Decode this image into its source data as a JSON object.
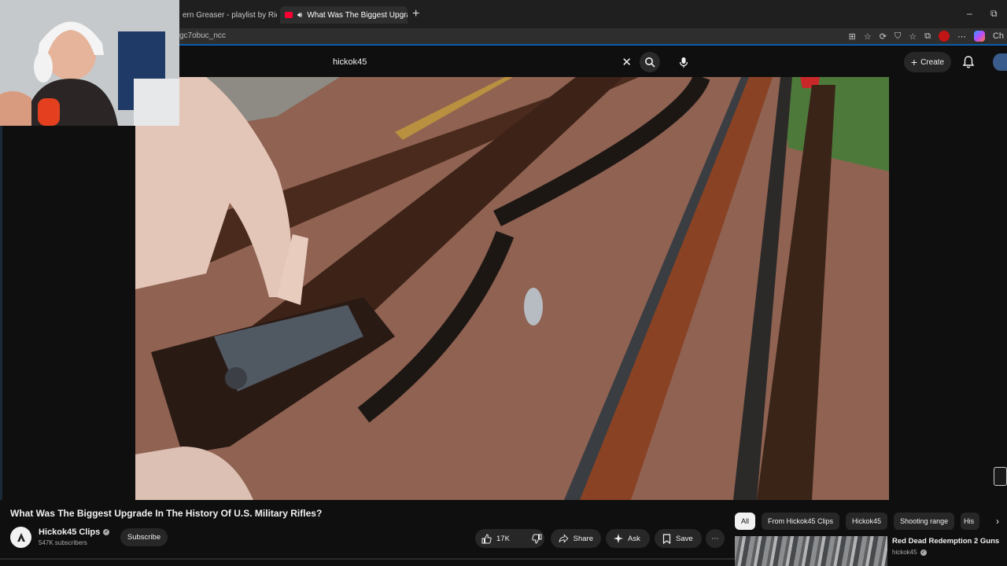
{
  "browser": {
    "tabs": [
      {
        "label": "ern Greaser - playlist by Rich",
        "active": false
      },
      {
        "label": "What Was The Biggest Upgra",
        "active": true
      }
    ],
    "url": "gc7obuc_ncc",
    "new_tab": "+",
    "window_controls": {
      "minimize": "–",
      "restore": "⧉"
    }
  },
  "header": {
    "search_query": "hickok45",
    "create_label": "Create"
  },
  "video": {
    "title": "What Was The Biggest Upgrade In The History Of U.S. Military Rifles?",
    "channel": "Hickok45 Clips",
    "subscribers": "547K subscribers",
    "subscribe_label": "Subscribe",
    "likes": "17K",
    "share_label": "Share",
    "ask_label": "Ask",
    "save_label": "Save"
  },
  "chips": [
    "All",
    "From Hickok45 Clips",
    "Hickok45",
    "Shooting range",
    "His"
  ],
  "recommendation": {
    "title": "Red Dead Redemption 2 Guns",
    "channel": "hickok45"
  },
  "colors": {
    "background": "#0f0f0f",
    "accent_red": "#ff0033",
    "pill": "#272727"
  }
}
